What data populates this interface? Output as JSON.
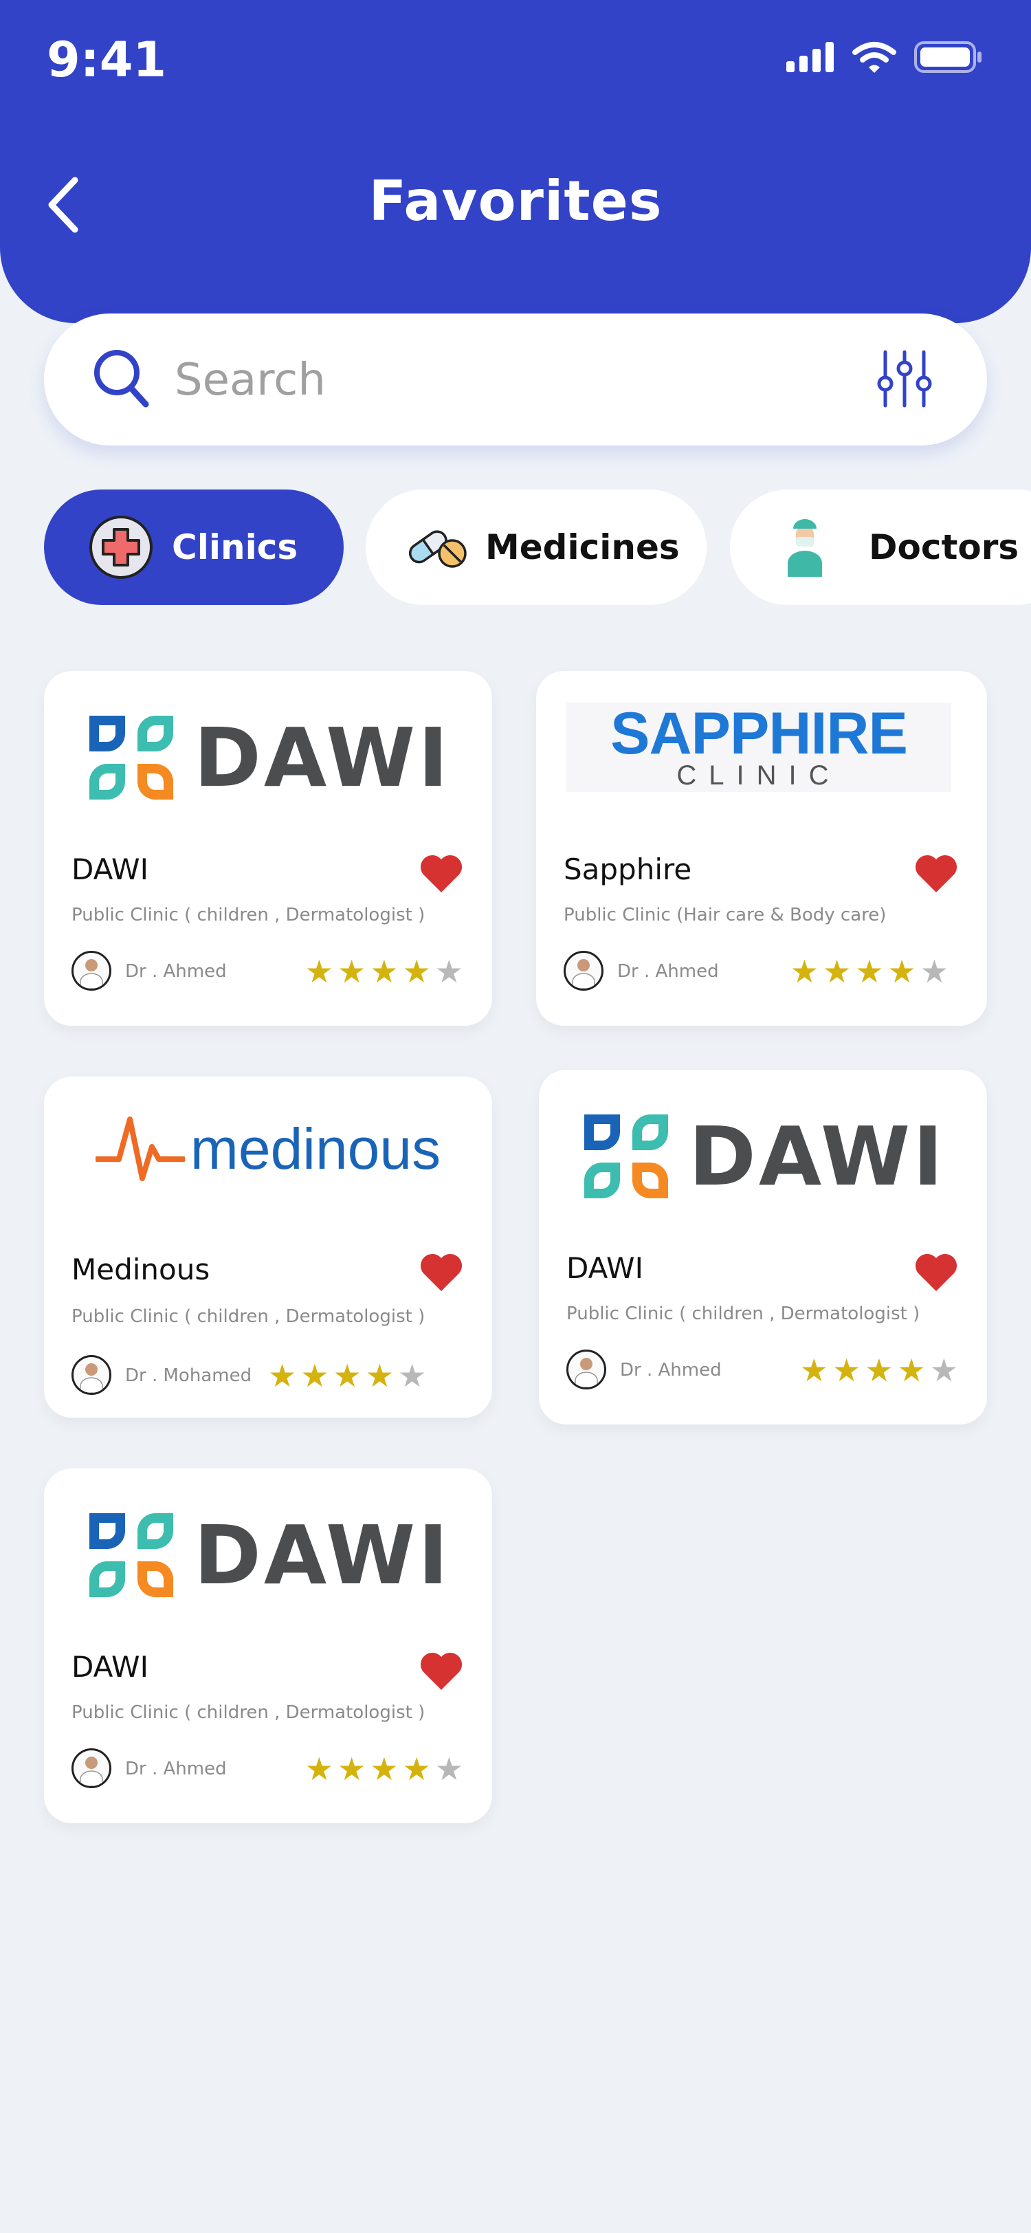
{
  "status": {
    "time": "9:41"
  },
  "header": {
    "title": "Favorites"
  },
  "search": {
    "placeholder": "Search",
    "value": ""
  },
  "categories": [
    {
      "label": "Clinics",
      "active": true
    },
    {
      "label": "Medicines",
      "active": false
    },
    {
      "label": "Doctors",
      "active": false
    }
  ],
  "favorites": [
    {
      "logo_text": "DAWI",
      "name": "DAWI",
      "description": "Public Clinic ( children , Dermatologist )",
      "doctor": "Dr . Ahmed",
      "rating": 4,
      "favorited": true
    },
    {
      "logo_text": "SAPPHIRE",
      "logo_subtext": "CLINIC",
      "name": "Sapphire",
      "description": "Public Clinic (Hair care & Body care)",
      "doctor": "Dr . Ahmed",
      "rating": 4,
      "favorited": true
    },
    {
      "logo_text": "medinous",
      "name": "Medinous",
      "description": "Public Clinic ( children , Dermatologist )",
      "doctor": "Dr . Mohamed",
      "rating": 4,
      "favorited": true
    },
    {
      "logo_text": "DAWI",
      "name": "DAWI",
      "description": "Public Clinic ( children , Dermatologist )",
      "doctor": "Dr . Ahmed",
      "rating": 4,
      "favorited": true
    },
    {
      "logo_text": "DAWI",
      "name": "DAWI",
      "description": "Public Clinic ( children , Dermatologist )",
      "doctor": "Dr . Ahmed",
      "rating": 4,
      "favorited": true
    }
  ],
  "colors": {
    "primary": "#3243c8",
    "star": "#d4b30e",
    "heart": "#d63232",
    "background": "#eef2f7"
  },
  "icons": [
    "back-arrow-icon",
    "search-icon",
    "filter-sliders-icon",
    "medical-cross-icon",
    "pill-icon",
    "doctor-icon",
    "heart-icon",
    "star-icon"
  ]
}
